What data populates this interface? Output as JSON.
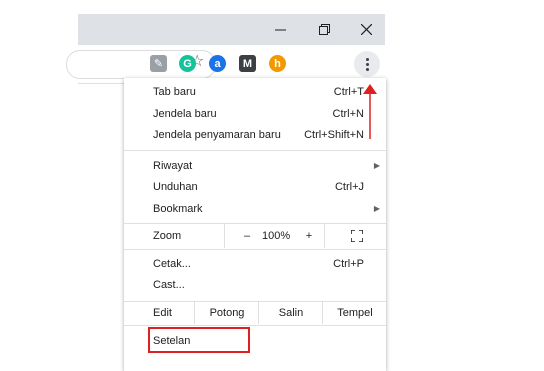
{
  "window": {
    "minimize_icon": "minimize-icon",
    "restore_icon": "restore-icon",
    "close_icon": "close-icon"
  },
  "toolbar": {
    "bookmark_icon": "star-icon",
    "extensions": [
      {
        "name": "pdf-extension-icon",
        "color": "#9aa0a6"
      },
      {
        "name": "grammarly-icon",
        "color": "#15c39a"
      },
      {
        "name": "extension-a-icon",
        "color": "#1a73e8"
      },
      {
        "name": "gmail-m-icon",
        "color": "#3c4043"
      },
      {
        "name": "honey-icon",
        "color": "#f29900"
      }
    ],
    "menu_icon": "kebab-menu-icon"
  },
  "menu": {
    "new_tab": {
      "label": "Tab baru",
      "shortcut": "Ctrl+T"
    },
    "new_window": {
      "label": "Jendela baru",
      "shortcut": "Ctrl+N"
    },
    "incognito": {
      "label": "Jendela penyamaran baru",
      "shortcut": "Ctrl+Shift+N"
    },
    "history": {
      "label": "Riwayat"
    },
    "downloads": {
      "label": "Unduhan",
      "shortcut": "Ctrl+J"
    },
    "bookmarks": {
      "label": "Bookmark"
    },
    "zoom": {
      "label": "Zoom",
      "minus": "–",
      "value": "100%",
      "plus": "+"
    },
    "print": {
      "label": "Cetak...",
      "shortcut": "Ctrl+P"
    },
    "cast": {
      "label": "Cast..."
    },
    "edit": {
      "label": "Edit",
      "cut": "Potong",
      "copy": "Salin",
      "paste": "Tempel"
    },
    "settings": {
      "label": "Setelan"
    }
  },
  "annotation": {
    "highlight_color": "#e02020"
  }
}
